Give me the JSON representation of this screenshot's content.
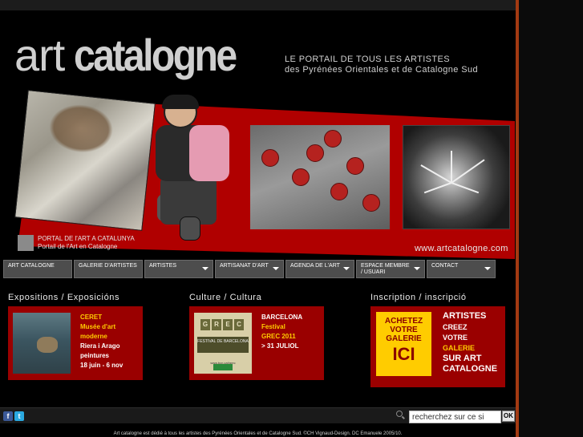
{
  "brand": {
    "logo_art": "art",
    "logo_catalogne": "catalogne",
    "tagline_line1": "LE PORTAIL DE TOUS LES ARTISTES",
    "tagline_line2": "des Pyrénées Orientales et de Catalogne Sud"
  },
  "banner": {
    "caption_line1": "PORTAL DE  l'ART A CATALUNYA",
    "caption_line2": "Portail de l'Art en Catalogne",
    "url": "www.artcatalogne.com"
  },
  "nav": {
    "items": [
      {
        "label": "ART CATALOGNE",
        "dropdown": false
      },
      {
        "label": "GALERIE D'ARTISTES",
        "dropdown": false
      },
      {
        "label": "ARTISTES",
        "dropdown": true
      },
      {
        "label": "ARTISANAT D'ART",
        "dropdown": true
      },
      {
        "label": "AGENDA DE L'ART",
        "dropdown": true
      },
      {
        "label": "ESPACE MEMBRE / USUARI",
        "dropdown": true
      },
      {
        "label": "CONTACT",
        "dropdown": true
      }
    ]
  },
  "sections": {
    "expositions": {
      "title": "Expositions / Exposicións",
      "line1": "CERET",
      "line2": "Musée d'art",
      "line3": "moderne",
      "line4": "Riera i Arago",
      "line5": "peintures",
      "line6": "18 juin - 6 nov"
    },
    "culture": {
      "title": "Culture / Cultura",
      "line1": "BARCELONA",
      "line2": "Festival",
      "line3": "GREC 2011",
      "line4": "> 31 JULIOL",
      "poster_letters": [
        "G",
        "R",
        "E",
        "C"
      ],
      "poster_band": "FESTIVAL DE BARCELONA",
      "poster_url": "www.bcn.cat/grec"
    },
    "inscription": {
      "title": "Inscription / inscripció",
      "badge_line1": "ACHETEZ",
      "badge_line2": "VOTRE",
      "badge_line3": "GALERIE",
      "badge_big": "ICI",
      "line1": "ARTISTES",
      "line2": "CREEZ",
      "line3": "VOTRE",
      "line4": "GALERIE",
      "line5": "SUR ART",
      "line6": "CATALOGNE"
    }
  },
  "bottombar": {
    "facebook_icon": "f",
    "twitter_icon": "t",
    "search_value": "recherchez sur ce si",
    "ok_label": "OK"
  },
  "footer": {
    "text": "Art catalogne est dédié à tous les artistes des Pyrénées Orientales et de Catalogne Sud. ©CH Vignaud-Design. DC Emanuele 2005/10."
  },
  "colors": {
    "accent_red": "#9a0000",
    "highlight_yellow": "#ffcc00",
    "frame_orange": "#a33a12",
    "nav_gray": "#4d4d4d"
  }
}
